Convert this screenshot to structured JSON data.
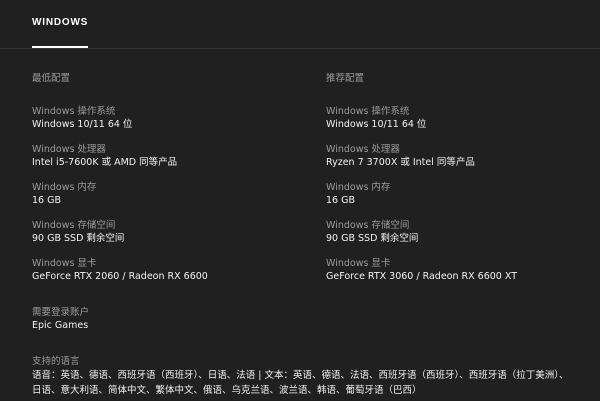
{
  "tabs": [
    {
      "label": "WINDOWS"
    }
  ],
  "minimum": {
    "heading": "最低配置",
    "specs": [
      {
        "label": "Windows 操作系统",
        "value": "Windows 10/11 64 位"
      },
      {
        "label": "Windows 处理器",
        "value": "Intel i5-7600K 或 AMD 同等产品"
      },
      {
        "label": "Windows 内存",
        "value": "16 GB"
      },
      {
        "label": "Windows 存储空间",
        "value": "90 GB SSD 剩余空间"
      },
      {
        "label": "Windows 显卡",
        "value": "GeForce RTX 2060 / Radeon RX 6600"
      }
    ]
  },
  "recommended": {
    "heading": "推荐配置",
    "specs": [
      {
        "label": "Windows 操作系统",
        "value": "Windows 10/11 64 位"
      },
      {
        "label": "Windows 处理器",
        "value": "Ryzen 7 3700X 或 Intel 同等产品"
      },
      {
        "label": "Windows 内存",
        "value": "16 GB"
      },
      {
        "label": "Windows 存储空间",
        "value": "90 GB SSD 剩余空间"
      },
      {
        "label": "Windows 显卡",
        "value": "GeForce RTX 3060 / Radeon RX 6600 XT"
      }
    ]
  },
  "account": {
    "label": "需要登录账户",
    "value": "Epic Games"
  },
  "languages": {
    "label": "支持的语言",
    "value": "语音：英语、德语、西班牙语（西班牙）、日语、法语 | 文本：英语、德语、法语、西班牙语（西班牙）、西班牙语（拉丁美洲）、日语、意大利语、简体中文、繁体中文、俄语、乌克兰语、波兰语、韩语、葡萄牙语（巴西）"
  }
}
